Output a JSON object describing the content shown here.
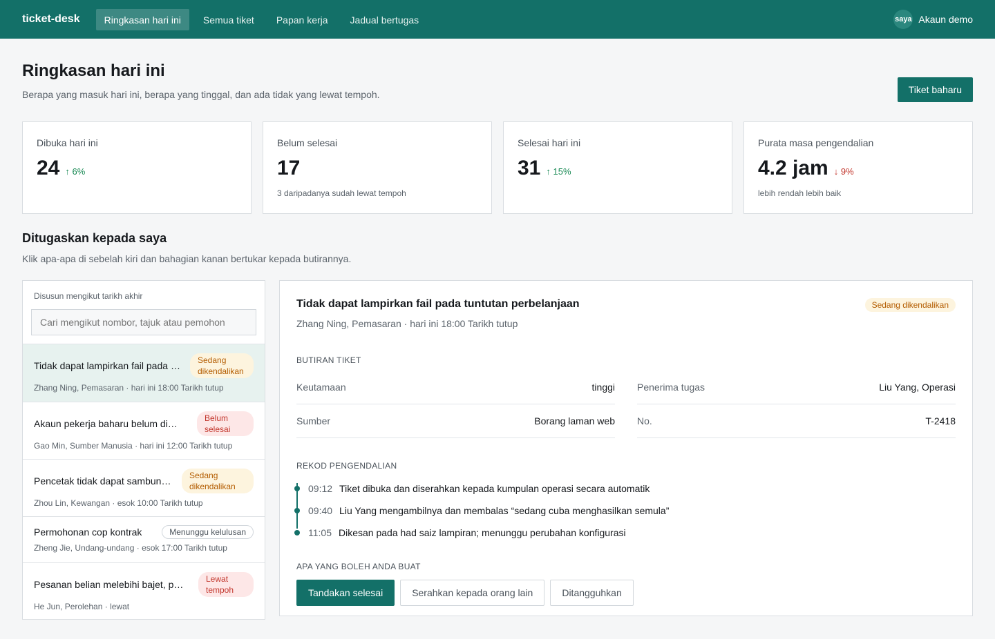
{
  "topbar": {
    "brand": "ticket-desk",
    "nav": [
      "Ringkasan hari ini",
      "Semua tiket",
      "Papan kerja",
      "Jadual bertugas"
    ],
    "avatar": "saya",
    "account": "Akaun demo"
  },
  "page": {
    "title": "Ringkasan hari ini",
    "subtitle": "Berapa yang masuk hari ini, berapa yang tinggal, dan ada tidak yang lewat tempoh.",
    "new_ticket": "Tiket baharu"
  },
  "stats": [
    {
      "label": "Dibuka hari ini",
      "value": "24",
      "delta": "↑ 6%",
      "note": ""
    },
    {
      "label": "Belum selesai",
      "value": "17",
      "delta": "",
      "note": "3 daripadanya sudah lewat tempoh"
    },
    {
      "label": "Selesai hari ini",
      "value": "31",
      "delta": "↑ 15%",
      "note": ""
    },
    {
      "label": "Purata masa pengendalian",
      "value": "4.2 jam",
      "delta": "↓ 9%",
      "note": "lebih rendah lebih baik"
    }
  ],
  "assigned": {
    "title": "Ditugaskan kepada saya",
    "subtitle": "Klik apa-apa di sebelah kiri dan bahagian kanan bertukar kepada butirannya."
  },
  "list": {
    "sort_label": "Disusun mengikut tarikh akhir",
    "search_placeholder": "Cari mengikut nombor, tajuk atau pemohon",
    "tickets": [
      {
        "title": "Tidak dapat lampirkan fail pada tuntutan perbelanjaan",
        "meta": "Zhang Ning, Pemasaran · hari ini 18:00 Tarikh tutup",
        "badge": "Sedang dikendalikan"
      },
      {
        "title": "Akaun pekerja baharu belum diaktifkan",
        "meta": "Gao Min, Sumber Manusia · hari ini 12:00 Tarikh tutup",
        "badge": "Belum selesai"
      },
      {
        "title": "Pencetak tidak dapat sambung ke rangkaian",
        "meta": "Zhou Lin, Kewangan · esok 10:00 Tarikh tutup",
        "badge": "Sedang dikendalikan"
      },
      {
        "title": "Permohonan cop kontrak",
        "meta": "Zheng Jie, Undang-undang · esok 17:00 Tarikh tutup",
        "badge": "Menunggu kelulusan"
      },
      {
        "title": "Pesanan belian melebihi bajet, perlu semakan",
        "meta": "He Jun, Perolehan · lewat",
        "badge": "Lewat tempoh"
      }
    ]
  },
  "detail": {
    "title": "Tidak dapat lampirkan fail pada tuntutan perbelanjaan",
    "subtitle": "Zhang Ning, Pemasaran · hari ini 18:00 Tarikh tutup",
    "badge": "Sedang dikendalikan",
    "details_caption": "BUTIRAN TIKET",
    "fields": {
      "priority_key": "Keutamaan",
      "priority_val": "tinggi",
      "assignee_key": "Penerima tugas",
      "assignee_val": "Liu Yang, Operasi",
      "source_key": "Sumber",
      "source_val": "Borang laman web",
      "no_key": "No.",
      "no_val": "T-2418"
    },
    "log_caption": "REKOD PENGENDALIAN",
    "log": [
      {
        "time": "09:12",
        "text": "Tiket dibuka dan diserahkan kepada kumpulan operasi secara automatik"
      },
      {
        "time": "09:40",
        "text": "Liu Yang mengambilnya dan membalas “sedang cuba menghasilkan semula”"
      },
      {
        "time": "11:05",
        "text": "Dikesan pada had saiz lampiran; menunggu perubahan konfigurasi"
      }
    ],
    "actions_caption": "APA YANG BOLEH ANDA BUAT",
    "actions": [
      "Tandakan selesai",
      "Serahkan kepada orang lain",
      "Ditangguhkan"
    ]
  }
}
